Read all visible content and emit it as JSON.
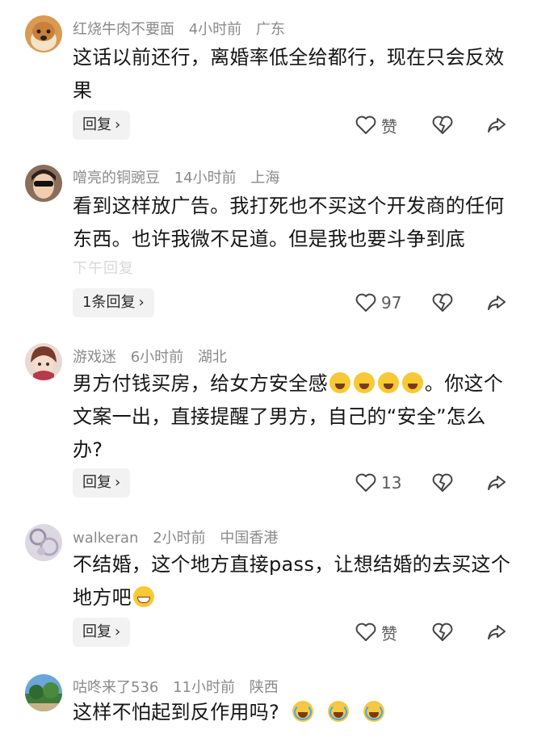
{
  "comments": [
    {
      "username": "红烧牛肉不要面",
      "time": "4小时前",
      "location": "广东",
      "text": "这话以前还行，离婚率低全给都行，现在只会反效果",
      "reply_label": "回复",
      "like_label": "赞"
    },
    {
      "username": "噌亮的铜豌豆",
      "time": "14小时前",
      "location": "上海",
      "text": "看到这样放广告。我打死也不买这个开发商的任何东西。也许我微不足道。但是我也要斗争到底",
      "faded_hint": "下午回复",
      "reply_label": "1条回复",
      "like_count": "97"
    },
    {
      "username": "游戏迷",
      "time": "6小时前",
      "location": "湖北",
      "text_before": "男方付钱买房，给女方安全感",
      "text_after": "。你这个文案一出，直接提醒了男方，自己的“安全”怎么办?",
      "reply_label": "回复",
      "like_count": "13"
    },
    {
      "username": "walkeran",
      "time": "2小时前",
      "location": "中国香港",
      "text": "不结婚，这个地方直接pass，让想结婚的去买这个地方吧",
      "reply_label": "回复",
      "like_label": "赞"
    },
    {
      "username": "咕咚来了536",
      "time": "11小时前",
      "location": "陕西",
      "text": "这样不怕起到反作用吗?"
    }
  ],
  "icons": {
    "like": "heart-outline-icon",
    "dislike": "broken-heart-icon",
    "share": "share-arrow-icon",
    "reply_chevron": "chevron-right-icon"
  }
}
